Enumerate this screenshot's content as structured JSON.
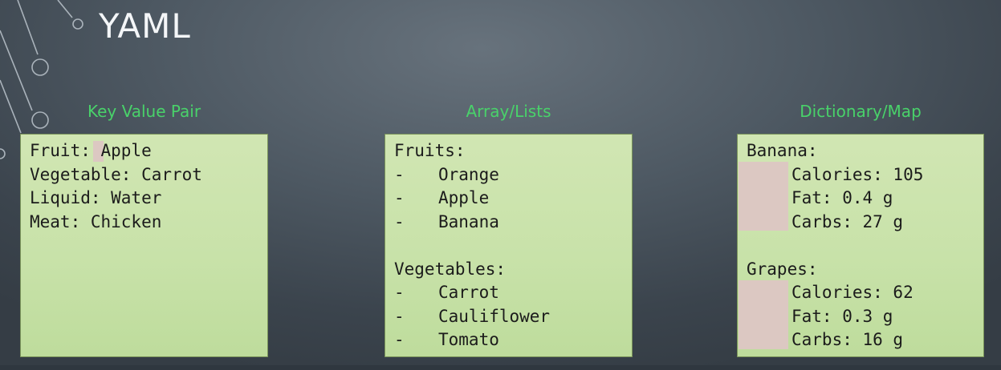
{
  "slide": {
    "title": "YAML",
    "background_color": "#4e5963"
  },
  "colors": {
    "heading_green": "#49d26a",
    "panel_green": "#c8e2a9",
    "highlight_pink": "#dcc8c2"
  },
  "sections": [
    {
      "heading": "Key Value Pair",
      "lines": {
        "l1": "Fruit: Apple",
        "l2": "Vegetable: Carrot",
        "l3": "Liquid: Water",
        "l4": "Meat: Chicken"
      }
    },
    {
      "heading": "Array/Lists",
      "fruits_key": "Fruits:",
      "fruits": [
        "Orange",
        "Apple",
        "Banana"
      ],
      "vegetables_key": "Vegetables:",
      "vegetables": [
        "Carrot",
        "Cauliflower",
        "Tomato"
      ],
      "bullet": "-"
    },
    {
      "heading": "Dictionary/Map",
      "maps": [
        {
          "key": "Banana:",
          "calories": "Calories: 105",
          "fat": "Fat: 0.4 g",
          "carbs": "Carbs: 27 g"
        },
        {
          "key": "Grapes:",
          "calories": "Calories: 62",
          "fat": "Fat: 0.3 g",
          "carbs": "Carbs: 16 g"
        }
      ]
    }
  ]
}
